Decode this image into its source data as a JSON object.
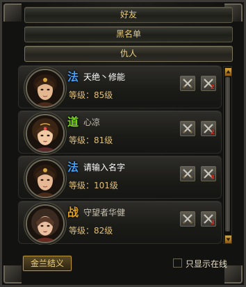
{
  "tabs": {
    "friends": "好友",
    "blacklist": "黑名单",
    "enemies": "仇人"
  },
  "list": {
    "rows": [
      {
        "class_char": "法",
        "class_color": "#3aa0ff",
        "name": "天绝丶修能",
        "level": "等级：85级",
        "btn2_num": "2"
      },
      {
        "class_char": "道",
        "class_color": "#7ed321",
        "name": "心凉",
        "level": "等级：81级",
        "btn2_num": "2"
      },
      {
        "class_char": "法",
        "class_color": "#3aa0ff",
        "name": "请输入名字",
        "level": "等级：101级",
        "btn2_num": "3"
      },
      {
        "class_char": "战",
        "class_color": "#e0a020",
        "name": "守望者华健",
        "level": "等级：82级",
        "btn2_num": "3"
      }
    ],
    "action_icon": "crossed-swords-icon"
  },
  "footer": {
    "sworn_button": "金兰结义",
    "online_only_label": "只显示在线",
    "online_only_checked": false
  },
  "colors": {
    "gold_text": "#e8c977",
    "level_text": "#e0bf7a",
    "frame": "#3b3a36"
  }
}
